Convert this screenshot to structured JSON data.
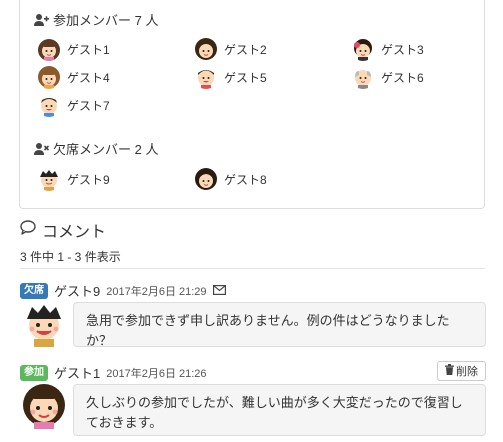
{
  "attending": {
    "title": "参加メンバー 7 人",
    "members": [
      {
        "name": "ゲスト1",
        "icon": "girl-avatar-icon"
      },
      {
        "name": "ゲスト2",
        "icon": "girl-avatar-icon"
      },
      {
        "name": "ゲスト3",
        "icon": "woman-avatar-icon"
      },
      {
        "name": "ゲスト4",
        "icon": "girl-avatar-icon"
      },
      {
        "name": "ゲスト5",
        "icon": "boy-avatar-icon"
      },
      {
        "name": "ゲスト6",
        "icon": "old-man-avatar-icon"
      },
      {
        "name": "ゲスト7",
        "icon": "man-avatar-icon"
      }
    ]
  },
  "absent": {
    "title": "欠席メンバー 2 人",
    "members": [
      {
        "name": "ゲスト9",
        "icon": "boy-avatar-icon"
      },
      {
        "name": "ゲスト8",
        "icon": "woman-avatar-icon"
      }
    ]
  },
  "comments": {
    "header": "コメント",
    "count_text": "3 件中 1 - 3 件表示",
    "items": [
      {
        "badge": "欠席",
        "badge_color": "#337ab7",
        "author": "ゲスト9",
        "timestamp": "2017年2月6日 21:29",
        "text": "急用で参加できず申し訳ありません。例の件はどうなりましたか？"
      },
      {
        "badge": "参加",
        "badge_color": "#5cb85c",
        "author": "ゲスト1",
        "timestamp": "2017年2月6日 21:26",
        "text": "久しぶりの参加でしたが、難しい曲が多く大変だったので復習しておきます。",
        "delete_label": "削除"
      }
    ]
  }
}
